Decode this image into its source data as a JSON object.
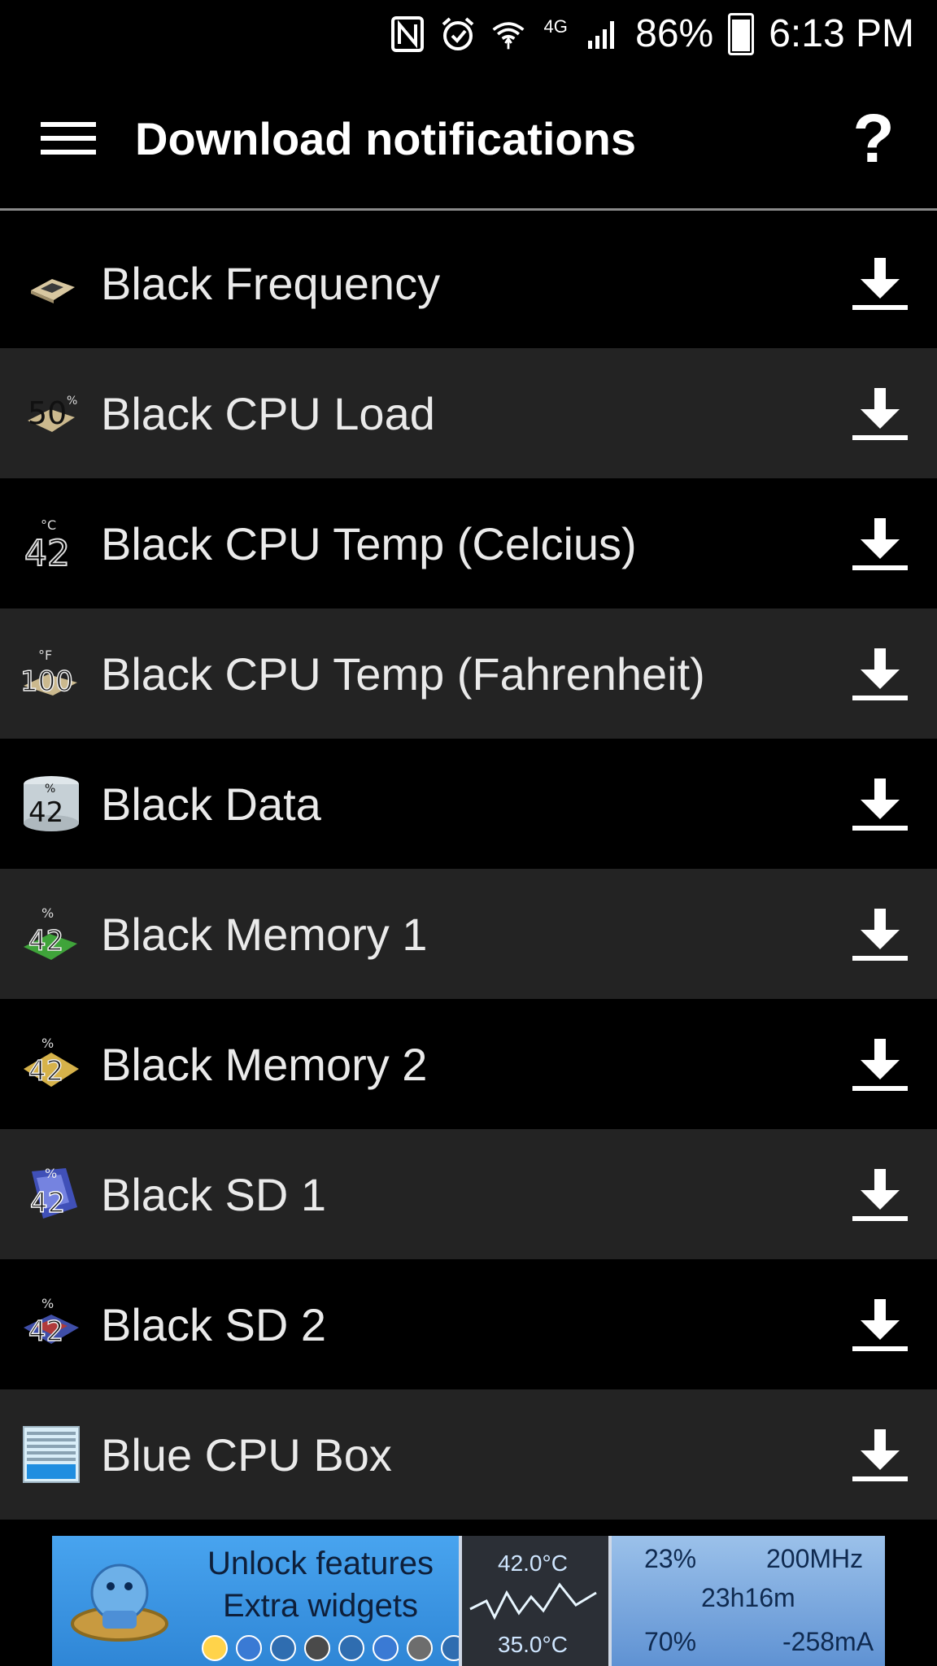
{
  "status_bar": {
    "battery": "86%",
    "time": "6:13 PM",
    "network": "4G",
    "icons": [
      "nfc-icon",
      "alarm-icon",
      "wifi-icon",
      "signal-icon",
      "battery-icon"
    ]
  },
  "app_bar": {
    "title": "Download notifications",
    "help": "?",
    "menu_icon": "hamburger-menu-icon"
  },
  "list": {
    "items": [
      {
        "label": "Black Frequency",
        "icon": "cpu-chip-icon"
      },
      {
        "label": "Black CPU Load",
        "icon": "cpu-load-icon",
        "icon_text": "50"
      },
      {
        "label": "Black CPU Temp (Celcius)",
        "icon": "temperature-celsius-icon",
        "icon_text": "42",
        "unit": "°C"
      },
      {
        "label": "Black CPU Temp (Fahrenheit)",
        "icon": "temperature-fahrenheit-icon",
        "icon_text": "100",
        "unit": "°F"
      },
      {
        "label": "Black Data",
        "icon": "data-storage-icon",
        "icon_text": "42",
        "unit": "%"
      },
      {
        "label": "Black Memory 1",
        "icon": "memory-green-icon",
        "icon_text": "42",
        "unit": "%"
      },
      {
        "label": "Black Memory 2",
        "icon": "memory-gold-icon",
        "icon_text": "42",
        "unit": "%"
      },
      {
        "label": "Black SD 1",
        "icon": "sd-card-blue-icon",
        "icon_text": "42",
        "unit": "%"
      },
      {
        "label": "Black SD 2",
        "icon": "sd-card-red-blue-icon",
        "icon_text": "42",
        "unit": "%"
      },
      {
        "label": "Blue CPU Box",
        "icon": "blue-cpu-box-icon"
      }
    ],
    "download_icon": "download-icon"
  },
  "ad_banner": {
    "line1": "Unlock features",
    "line2": "Extra widgets",
    "temp_top": "42.0°C",
    "temp_bottom": "35.0°C",
    "pct_top": "23%",
    "freq": "200MHz",
    "uptime": "23h16m",
    "pct_bottom": "70%",
    "current": "-258mA"
  },
  "colors": {
    "background": "#000000",
    "row_alt": "#232323",
    "text": "#eaeaea",
    "ad_blue": "#3f8ddf"
  }
}
